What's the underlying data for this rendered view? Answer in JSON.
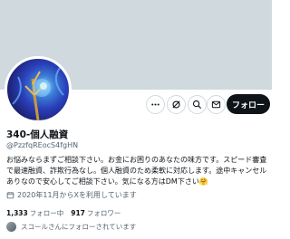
{
  "profile": {
    "name": "340-個人融資",
    "handle": "@PzzfqREocS4fgHN",
    "bio": "お悩みならまずご相談下さい。お金にお困りのあなたの味方です。スピード審査で最速融資、詐欺行為なし。個人融資のため柔軟に対応します。途中キャンセルありなので安心してご相談下さい。気になる方はDM下さい🤗",
    "joined": "2020年11月からXを利用しています",
    "following_count": "1,333",
    "following_label": "フォロー中",
    "followers_count": "917",
    "followers_label": "フォロワー",
    "followed_by": "スコールさんにフォローされています"
  },
  "actions": {
    "follow_label": "フォロー"
  },
  "icons": {
    "more": "more-icon",
    "grok": "grok-icon",
    "search": "search-icon",
    "message": "message-icon",
    "calendar": "calendar-icon"
  },
  "colors": {
    "banner": "#cfd9de",
    "follow_button": "#0f1419",
    "secondary_text": "#536471"
  }
}
